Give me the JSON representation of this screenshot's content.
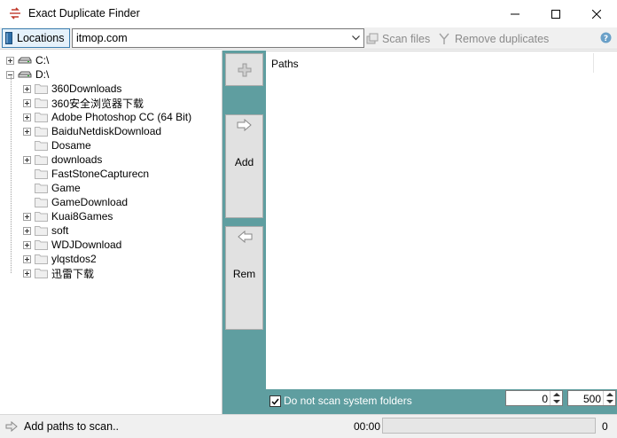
{
  "window": {
    "title": "Exact Duplicate Finder",
    "icon": "app-logo-icon",
    "controls": [
      "minimize-icon",
      "maximize-icon",
      "close-icon"
    ]
  },
  "toolbar": {
    "locations_label": "Locations",
    "address_value": "itmop.com",
    "scan_label": "Scan files",
    "remove_label": "Remove duplicates",
    "disabled_color": "#8a8a8a"
  },
  "tree": {
    "drives": [
      {
        "label": "C:\\",
        "expanded": false
      },
      {
        "label": "D:\\",
        "expanded": true
      }
    ],
    "folders": [
      {
        "label": "360Downloads",
        "has_children": true
      },
      {
        "label": "360安全浏览器下载",
        "has_children": true
      },
      {
        "label": "Adobe Photoshop CC (64 Bit)",
        "has_children": true
      },
      {
        "label": "BaiduNetdiskDownload",
        "has_children": true
      },
      {
        "label": "Dosame",
        "has_children": false
      },
      {
        "label": "downloads",
        "has_children": true
      },
      {
        "label": "FastStoneCapturecn",
        "has_children": false
      },
      {
        "label": "Game",
        "has_children": false
      },
      {
        "label": "GameDownload",
        "has_children": false
      },
      {
        "label": "Kuai8Games",
        "has_children": true
      },
      {
        "label": "soft",
        "has_children": true
      },
      {
        "label": "WDJDownload",
        "has_children": true
      },
      {
        "label": "ylqstdos2",
        "has_children": true
      },
      {
        "label": "迅雷下载",
        "has_children": true
      }
    ]
  },
  "side_buttons": {
    "add_label": "Add",
    "rem_label": "Rem"
  },
  "paths": {
    "header": "Paths"
  },
  "options": {
    "skip_system_label": "Do not scan system folders",
    "skip_system_checked": true,
    "min_value": "0",
    "max_value": "500"
  },
  "status": {
    "message": "Add paths to scan..",
    "elapsed": "00:00",
    "progress": 0,
    "count": "0"
  },
  "colors": {
    "accent_teal": "#5f9ea0",
    "app_icon_red": "#c0392b"
  }
}
